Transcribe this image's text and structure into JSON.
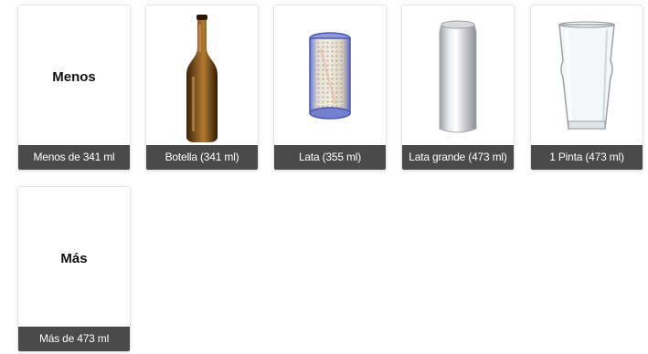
{
  "options": [
    {
      "label": "Menos de 341 ml",
      "visual_text": "Menos",
      "icon": "text-placeholder"
    },
    {
      "label": "Botella (341 ml)",
      "icon": "beer-bottle-icon"
    },
    {
      "label": "Lata (355 ml)",
      "icon": "beer-can-icon"
    },
    {
      "label": "Lata grande (473 ml)",
      "icon": "tall-can-icon"
    },
    {
      "label": "1 Pinta (473 ml)",
      "icon": "pint-glass-icon"
    },
    {
      "label": "Más de 473 ml",
      "visual_text": "Más",
      "icon": "text-placeholder"
    }
  ],
  "colors": {
    "caption_bg": "#4a4a4a",
    "caption_text": "#ffffff",
    "card_border": "#e6e6e6"
  }
}
